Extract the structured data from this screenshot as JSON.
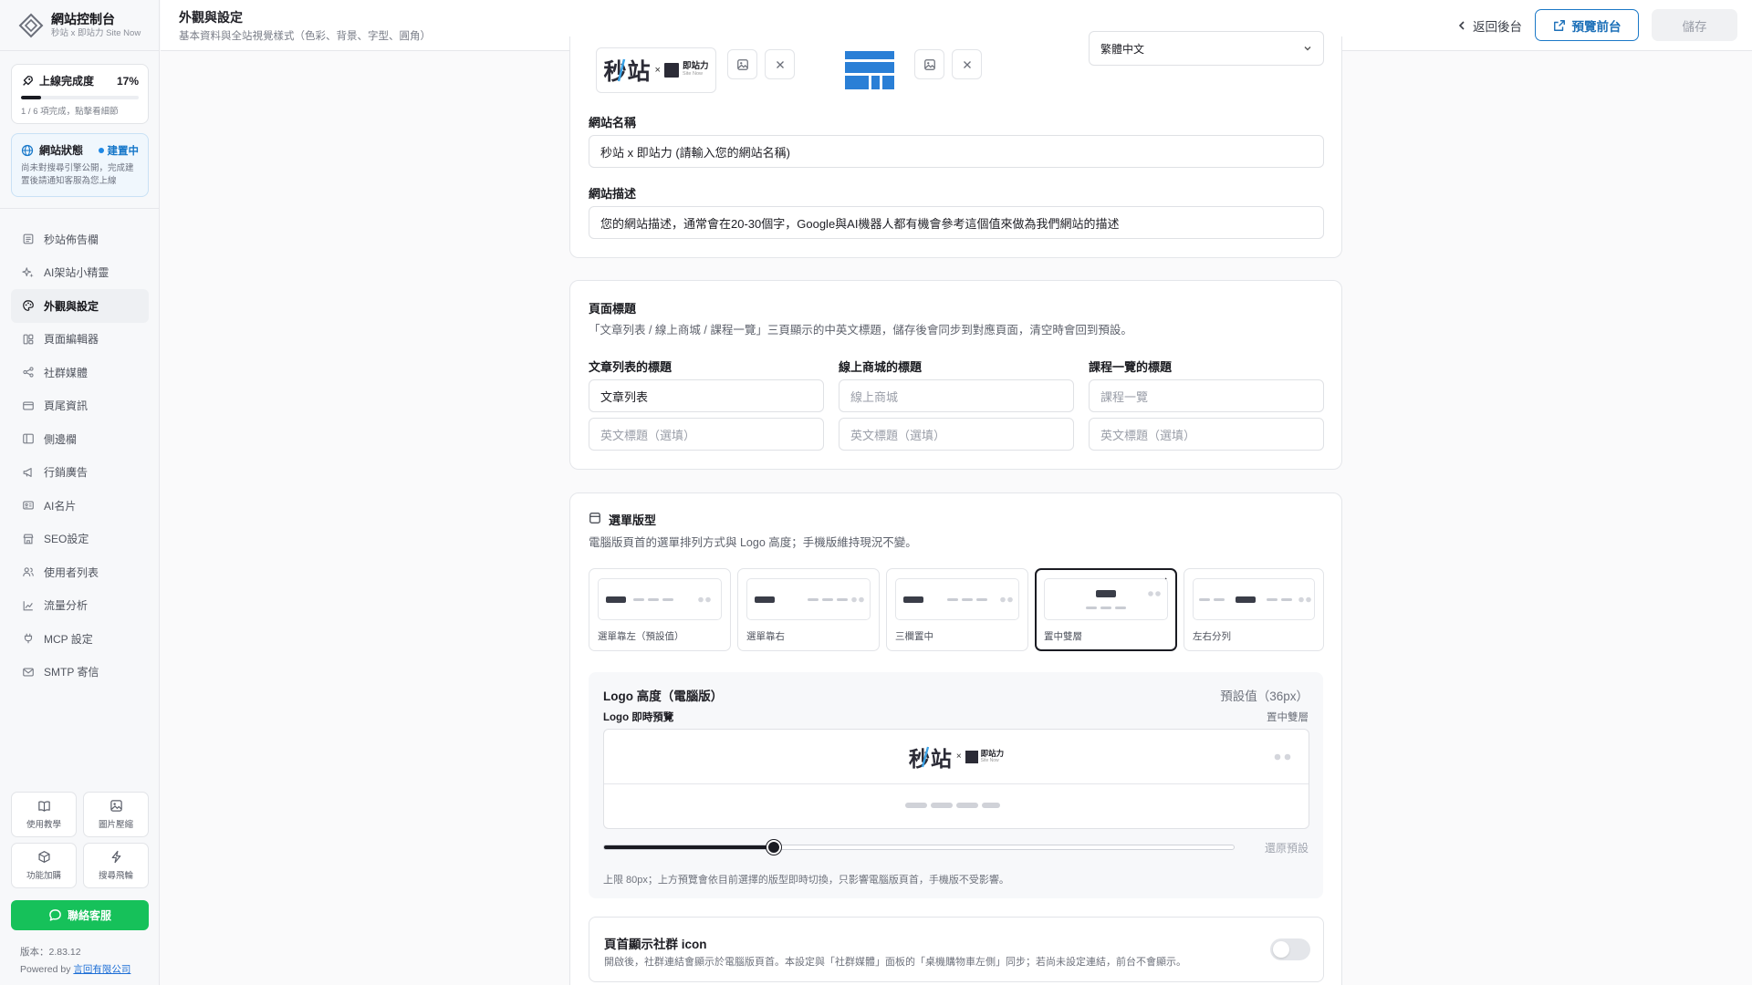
{
  "brand": {
    "title": "網站控制台",
    "subtitle": "秒站 x 即站力 Site Now"
  },
  "progress": {
    "label": "上線完成度",
    "percent_text": "17%",
    "fraction": 0.17,
    "hint": "1 / 6 項完成，點擊看細節"
  },
  "status": {
    "label": "網站狀態",
    "badge": "建置中",
    "text": "尚未對搜尋引擎公開，完成建置後請通知客服為您上線"
  },
  "nav": [
    {
      "label": "秒站佈告欄",
      "icon": "notice-board-icon"
    },
    {
      "label": "AI架站小精靈",
      "icon": "sparkle-icon"
    },
    {
      "label": "外觀與設定",
      "icon": "palette-icon",
      "active": true
    },
    {
      "label": "頁面編輯器",
      "icon": "layout-icon"
    },
    {
      "label": "社群媒體",
      "icon": "share-icon"
    },
    {
      "label": "頁尾資訊",
      "icon": "card-icon"
    },
    {
      "label": "側邊欄",
      "icon": "sidebar-icon"
    },
    {
      "label": "行銷廣告",
      "icon": "megaphone-icon"
    },
    {
      "label": "AI名片",
      "icon": "id-card-icon"
    },
    {
      "label": "SEO設定",
      "icon": "store-icon"
    },
    {
      "label": "使用者列表",
      "icon": "users-icon"
    },
    {
      "label": "流量分析",
      "icon": "chart-icon"
    },
    {
      "label": "MCP 設定",
      "icon": "plug-icon"
    },
    {
      "label": "SMTP 寄信",
      "icon": "mail-icon"
    }
  ],
  "tools": [
    {
      "label": "使用教學",
      "icon": "book-icon"
    },
    {
      "label": "圖片壓縮",
      "icon": "image-icon"
    },
    {
      "label": "功能加購",
      "icon": "package-icon"
    },
    {
      "label": "搜尋飛輪",
      "icon": "bolt-icon"
    }
  ],
  "contact_label": "聯絡客服",
  "version_text": "版本：2.83.12",
  "powered_prefix": "Powered by ",
  "powered_link": "言回有限公司",
  "header": {
    "title": "外觀與設定",
    "subtitle": "基本資料與全站視覺樣式（色彩、背景、字型、圓角）",
    "back_label": "返回後台",
    "preview_label": "預覽前台",
    "save_label": "儲存"
  },
  "basic": {
    "logo_text_main": "秒站",
    "logo_text_x": "×",
    "logo_text_brand": "即站力",
    "logo_text_brand_sub": "Site Now",
    "language_partial": "繁體中文",
    "site_name_label": "網站名稱",
    "site_name_value": "秒站 x 即站力 (請輸入您的網站名稱)",
    "site_desc_label": "網站描述",
    "site_desc_value": "您的網站描述，通常會在20-30個字，Google與AI機器人都有機會參考這個值來做為我們網站的描述"
  },
  "page_titles": {
    "title": "頁面標題",
    "desc": "「文章列表 / 線上商城 / 課程一覽」三頁顯示的中英文標題，儲存後會同步到對應頁面，清空時會回到預設。",
    "columns": [
      {
        "label": "文章列表的標題",
        "zh_value": "文章列表",
        "zh_placeholder": "",
        "en_placeholder": "英文標題（選填）"
      },
      {
        "label": "線上商城的標題",
        "zh_value": "",
        "zh_placeholder": "線上商城",
        "en_placeholder": "英文標題（選填）"
      },
      {
        "label": "課程一覽的標題",
        "zh_value": "",
        "zh_placeholder": "課程一覽",
        "en_placeholder": "英文標題（選填）"
      }
    ]
  },
  "menu_layout": {
    "title": "選單版型",
    "desc": "電腦版頁首的選單排列方式與 Logo 高度；手機版維持現況不變。",
    "options": [
      {
        "label": "選單靠左（預設值）",
        "selected": false
      },
      {
        "label": "選單靠右",
        "selected": false
      },
      {
        "label": "三欄置中",
        "selected": false
      },
      {
        "label": "置中雙層",
        "selected": true
      },
      {
        "label": "左右分列",
        "selected": false
      }
    ],
    "logo_height_title": "Logo 高度（電腦版）",
    "logo_height_default": "預設值（36px）",
    "live_preview_label": "Logo 即時預覽",
    "live_preview_layout": "置中雙層",
    "slider_value_fraction": 0.27,
    "reset_label": "還原預設",
    "limit_hint": "上限 80px；上方預覽會依目前選擇的版型即時切換，只影響電腦版頁首，手機版不受影響。"
  },
  "social": {
    "title": "頁首顯示社群 icon",
    "desc": "開啟後，社群連結會顯示於電腦版頁首。本設定與「社群媒體」面板的「桌機購物車左側」同步；若尚未設定連結，前台不會顯示。",
    "enabled": false
  },
  "colors": {
    "accent": "#1b78c7",
    "contact_green": "#16c15a",
    "logo_blue": "#2a7fd6",
    "dark": "#1a1b22"
  }
}
